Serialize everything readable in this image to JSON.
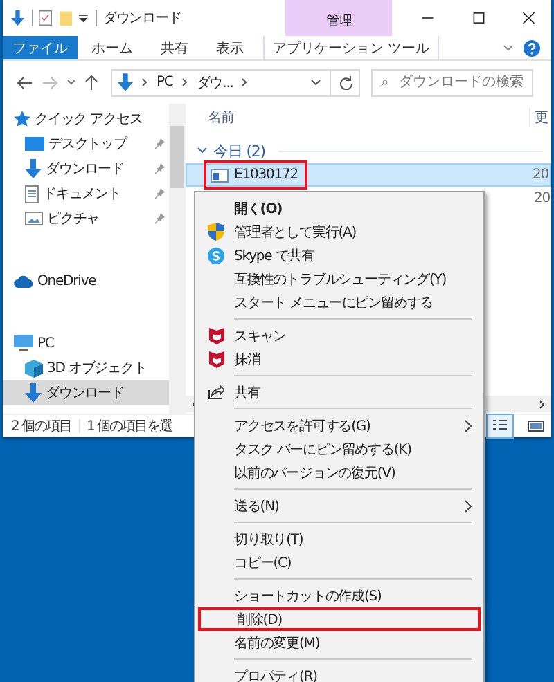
{
  "window": {
    "title": "ダウンロード",
    "context_tab": "管理"
  },
  "ribbon_tabs": [
    {
      "label": "ファイル",
      "kind": "file",
      "selected": false
    },
    {
      "label": "ホーム",
      "kind": "tab",
      "selected": false
    },
    {
      "label": "共有",
      "kind": "tab",
      "selected": false
    },
    {
      "label": "表示",
      "kind": "tab",
      "selected": false
    },
    {
      "label": "アプリケーション ツール",
      "kind": "context",
      "selected": false
    }
  ],
  "address": {
    "segments": [
      "PC",
      "ダウ..."
    ]
  },
  "search": {
    "placeholder": "ダウンロードの検索"
  },
  "nav_pane": [
    {
      "label": "クイック アクセス",
      "kind": "quick",
      "pinned": false,
      "selected": false,
      "children": [
        {
          "label": "デスクトップ",
          "kind": "desktop",
          "pinned": true,
          "selected": false
        },
        {
          "label": "ダウンロード",
          "kind": "download",
          "pinned": true,
          "selected": false
        },
        {
          "label": "ドキュメント",
          "kind": "document",
          "pinned": true,
          "selected": false
        },
        {
          "label": "ピクチャ",
          "kind": "picture",
          "pinned": true,
          "selected": false
        }
      ]
    },
    {
      "label": "OneDrive",
      "kind": "cloud",
      "pinned": false,
      "selected": false
    },
    {
      "label": "PC",
      "kind": "pc",
      "pinned": false,
      "selected": false,
      "children": [
        {
          "label": "3D オブジェクト",
          "kind": "cube",
          "pinned": false,
          "selected": false
        },
        {
          "label": "ダウンロード",
          "kind": "download",
          "pinned": false,
          "selected": true
        }
      ]
    }
  ],
  "columns": [
    "名前",
    "更"
  ],
  "groups": [
    {
      "label": "今日 (2)",
      "expanded": true,
      "rows": [
        {
          "name": "E1030172",
          "date": "20",
          "selected": true,
          "highlighted": true
        },
        {
          "date": "20",
          "selected": false
        }
      ]
    }
  ],
  "status_bar": [
    "2 個の項目",
    "1 個の項目を選"
  ],
  "context_menu": [
    {
      "kind": "plain",
      "label": "開く(O)",
      "bold": true,
      "submenu": false,
      "highlighted": false
    },
    {
      "kind": "shield",
      "label": "管理者として実行(A)",
      "bold": false,
      "submenu": false,
      "highlighted": false
    },
    {
      "kind": "skype",
      "label": "Skype で共有",
      "bold": false,
      "submenu": false,
      "highlighted": false
    },
    {
      "kind": "plain",
      "label": "互換性のトラブルシューティング(Y)",
      "bold": false,
      "submenu": false,
      "highlighted": false
    },
    {
      "kind": "plain",
      "label": "スタート メニューにピン留めする",
      "bold": false,
      "submenu": false,
      "highlighted": false
    },
    {
      "kind": "separator"
    },
    {
      "kind": "antivirus",
      "label": "スキャン",
      "bold": false,
      "submenu": false,
      "highlighted": false
    },
    {
      "kind": "antivirus",
      "label": "抹消",
      "bold": false,
      "submenu": false,
      "highlighted": false
    },
    {
      "kind": "separator"
    },
    {
      "kind": "share",
      "label": "共有",
      "bold": false,
      "submenu": false,
      "highlighted": false
    },
    {
      "kind": "separator"
    },
    {
      "kind": "plain",
      "label": "アクセスを許可する(G)",
      "bold": false,
      "submenu": true,
      "highlighted": false
    },
    {
      "kind": "plain",
      "label": "タスク バーにピン留めする(K)",
      "bold": false,
      "submenu": false,
      "highlighted": false
    },
    {
      "kind": "plain",
      "label": "以前のバージョンの復元(V)",
      "bold": false,
      "submenu": false,
      "highlighted": false
    },
    {
      "kind": "separator"
    },
    {
      "kind": "plain",
      "label": "送る(N)",
      "bold": false,
      "submenu": true,
      "highlighted": false
    },
    {
      "kind": "separator"
    },
    {
      "kind": "plain",
      "label": "切り取り(T)",
      "bold": false,
      "submenu": false,
      "highlighted": false
    },
    {
      "kind": "plain",
      "label": "コピー(C)",
      "bold": false,
      "submenu": false,
      "highlighted": false
    },
    {
      "kind": "separator"
    },
    {
      "kind": "plain",
      "label": "ショートカットの作成(S)",
      "bold": false,
      "submenu": false,
      "highlighted": false
    },
    {
      "kind": "plain",
      "label": "削除(D)",
      "bold": false,
      "submenu": false,
      "highlighted": true
    },
    {
      "kind": "plain",
      "label": "名前の変更(M)",
      "bold": false,
      "submenu": false,
      "highlighted": false
    },
    {
      "kind": "separator"
    },
    {
      "kind": "plain",
      "label": "プロパティ(R)",
      "bold": false,
      "submenu": false,
      "highlighted": false
    }
  ]
}
